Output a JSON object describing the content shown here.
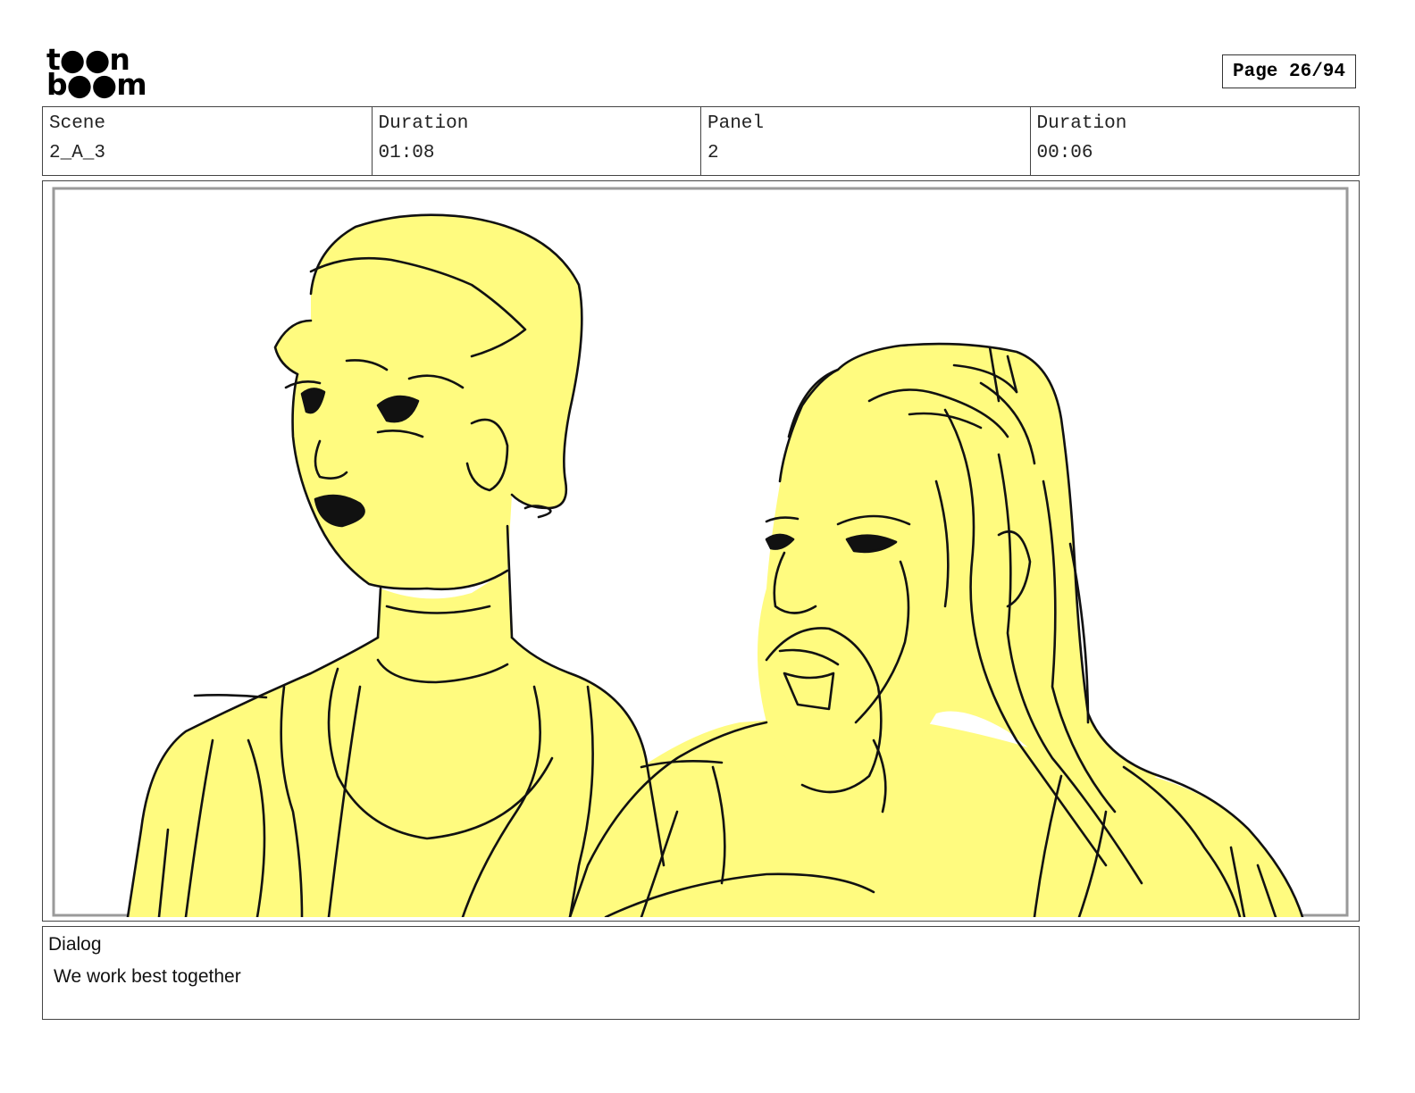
{
  "header": {
    "logo_line1": "t●●n",
    "logo_line2": "b●●m",
    "page_label": "Page 26/94"
  },
  "info": {
    "scene_label": "Scene",
    "scene_value": "2_A_3",
    "scene_duration_label": "Duration",
    "scene_duration_value": "01:08",
    "panel_label": "Panel",
    "panel_value": "2",
    "panel_duration_label": "Duration",
    "panel_duration_value": "00:06"
  },
  "panel": {
    "fill_color": "#fffb7f",
    "line_color": "#111111",
    "frame_color": "#9a9a9a"
  },
  "dialog": {
    "label": "Dialog",
    "text": "We work best together"
  }
}
